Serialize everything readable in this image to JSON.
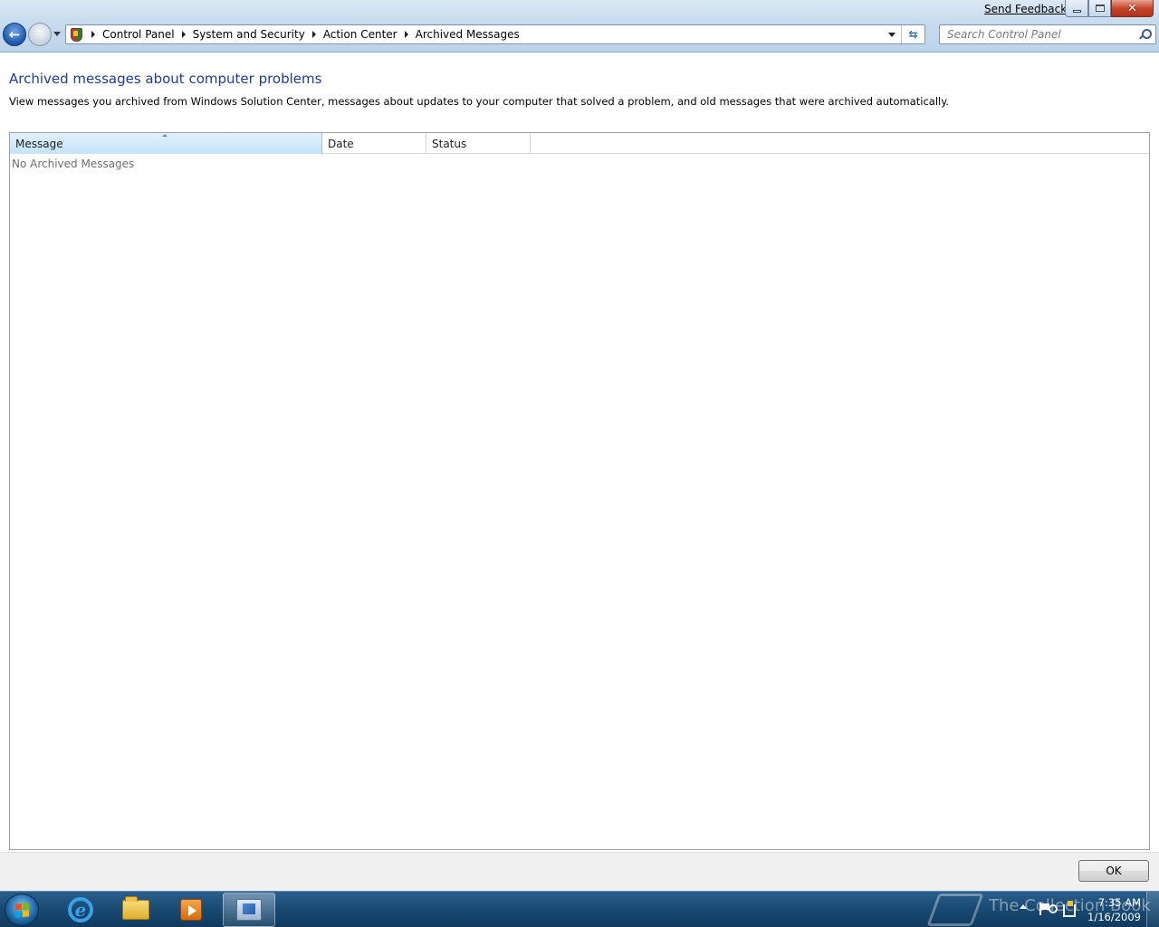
{
  "window": {
    "send_feedback": "Send Feedback",
    "close_glyph": "✕"
  },
  "address_bar": {
    "crumbs": [
      "Control Panel",
      "System and Security",
      "Action Center",
      "Archived Messages"
    ]
  },
  "search": {
    "placeholder": "Search Control Panel"
  },
  "page": {
    "title": "Archived messages about computer problems",
    "description": "View messages you archived from Windows Solution Center, messages about updates to your computer that solved a problem, and old messages that were archived automatically."
  },
  "list": {
    "columns": [
      "Message",
      "Date",
      "Status"
    ],
    "empty_text": "No Archived Messages"
  },
  "footer": {
    "ok_label": "OK"
  },
  "taskbar": {
    "watermark": "The Collection Book",
    "time": "7:35 AM",
    "date": "1/16/2009",
    "ie_glyph": "e"
  },
  "colors": {
    "title_blue": "#1e3d8f",
    "taskbar": "#1a4b74"
  }
}
